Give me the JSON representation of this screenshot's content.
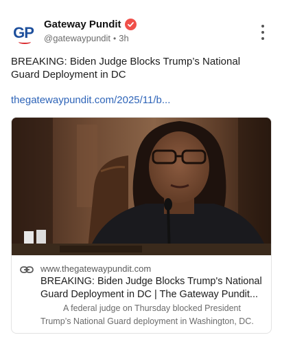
{
  "account": {
    "avatar_text": "GP",
    "display_name": "Gateway Pundit",
    "handle": "@gatewaypundit",
    "separator": "•",
    "time": "3h",
    "verified_icon": "verified-badge-icon",
    "verified_color": "#f0504a"
  },
  "post": {
    "text": "BREAKING: Biden Judge Blocks Trump’s National Guard Deployment in DC",
    "link": "thegatewaypundit.com/2025/11/b..."
  },
  "card": {
    "domain": "www.thegatewaypundit.com",
    "title": "BREAKING: Biden Judge Blocks Trump's National Guard Deployment in DC | The Gateway Pundit...",
    "description_line1": "A federal judge on Thursday blocked President",
    "description_line2": "Trump’s National Guard deployment in Washington, DC."
  },
  "colors": {
    "link": "#2e64b8",
    "brand_blue": "#1d4f9c",
    "brand_red": "#d9262b"
  }
}
